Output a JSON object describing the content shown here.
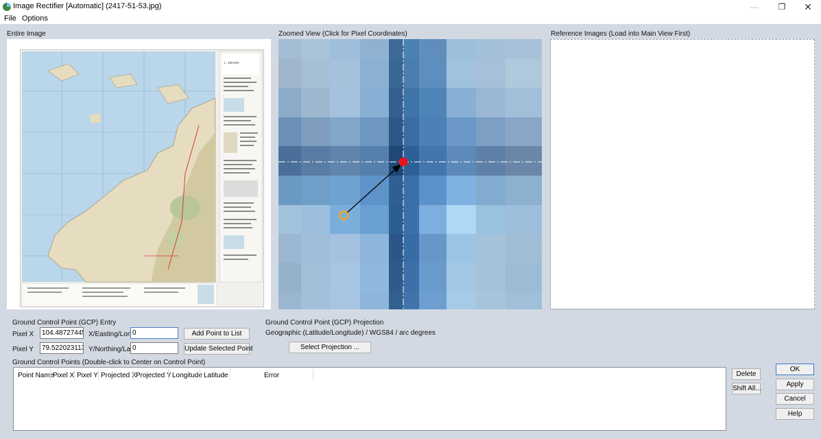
{
  "window": {
    "title": "Image Rectifier [Automatic] (2417-51-53.jpg)",
    "controls": {
      "minimize": "—",
      "maximize": "❐",
      "close": "✕"
    }
  },
  "menu": {
    "items": [
      "File",
      "Options"
    ]
  },
  "panels": {
    "entire_image_label": "Entire Image",
    "zoomed_view_label": "Zoomed View (Click for Pixel Coordinates)",
    "reference_label": "Reference Images (Load into Main View First)"
  },
  "zoom": {
    "grid_colors": [
      [
        "#a4bcd4",
        "#a9c4d9",
        "#9fbedc",
        "#8fb2d3",
        "#3e6a9a",
        "#4b80b2",
        "#5f8ebd",
        "#9ebfda",
        "#a4c0d8",
        "#a7c1d8"
      ],
      [
        "#9fb6cc",
        "#a7bfd4",
        "#a5c1db",
        "#8ab0d2",
        "#3b6797",
        "#4a7eb1",
        "#5d8ebe",
        "#a1c2df",
        "#a5c0d8",
        "#b0c8dc"
      ],
      [
        "#8cabc8",
        "#9db7cf",
        "#a4c2dd",
        "#88b0d4",
        "#355f8f",
        "#3f74a8",
        "#4f84b9",
        "#88b0d4",
        "#9ab8d6",
        "#a2bfd9"
      ],
      [
        "#6b8fb5",
        "#7f9dbf",
        "#81a6c8",
        "#6e98c1",
        "#2d5788",
        "#3a6ea3",
        "#4b80b8",
        "#6b98c6",
        "#7e9fc4",
        "#8aa6c6"
      ],
      [
        "#4a6f98",
        "#587ca4",
        "#5f85ad",
        "#557fac",
        "#1f4878",
        "#2f5f97",
        "#4375ae",
        "#5d89b9",
        "#5f80a8",
        "#6a86a8"
      ],
      [
        "#6a99c2",
        "#6f9ec8",
        "#6ea2d0",
        "#5d93c8",
        "#2f5f93",
        "#3a70a9",
        "#5b92cc",
        "#7fb2e0",
        "#82abd0",
        "#8bb0d0"
      ],
      [
        "#a2c2de",
        "#9cbfe0",
        "#7aaedb",
        "#6a9fd3",
        "#2d5d91",
        "#3b71aa",
        "#7eaedd",
        "#aed8f5",
        "#99c1e0",
        "#9dbfdc"
      ],
      [
        "#9bb6d0",
        "#a0bed9",
        "#a4c2e0",
        "#8eb6dc",
        "#2b568a",
        "#386ca5",
        "#6797c9",
        "#9cc4e4",
        "#a4c3db",
        "#a0bfd7"
      ],
      [
        "#95b2cd",
        "#a2bfda",
        "#a8c6e2",
        "#8fb8de",
        "#2f5a8c",
        "#3d70a8",
        "#6a9bcd",
        "#a3c8e6",
        "#a6c2da",
        "#9cbcd6"
      ],
      [
        "#9ab6d1",
        "#a3c0db",
        "#a7c5e1",
        "#8eb6dc",
        "#32608f",
        "#4174ab",
        "#6d9ecf",
        "#a6cbe8",
        "#a8c4dc",
        "#a0bfd8"
      ]
    ],
    "marker_colors": {
      "target": "#e8141c",
      "source": "#f0a81c",
      "arrow": "#000000",
      "crosshair": "#ffffff"
    }
  },
  "gcp_entry": {
    "label": "Ground Control Point (GCP) Entry",
    "pixel_x_label": "Pixel X",
    "pixel_x_value": "104.4872744593",
    "pixel_y_label": "Pixel Y",
    "pixel_y_value": "79.5220231133",
    "x_label": "X/Easting/Lon",
    "x_value": "0",
    "y_label": "Y/Northing/Lat",
    "y_value": "0",
    "add_button": "Add Point to List",
    "update_button": "Update Selected Point"
  },
  "gcp_projection": {
    "label": "Ground Control Point (GCP) Projection",
    "value": "Geographic (Latitude/Longitude) / WGS84 / arc degrees",
    "select_button": "Select Projection ..."
  },
  "gcp_list": {
    "label": "Ground Control Points (Double-click to Center on Control Point)",
    "columns": [
      "Point Name",
      "Pixel X",
      "Pixel Y",
      "Projected X",
      "Projected Y",
      "Longitude",
      "Latitude",
      "Error"
    ]
  },
  "side_buttons": {
    "delete": "Delete",
    "shift_all": "Shift All..."
  },
  "dialog_buttons": {
    "ok": "OK",
    "apply": "Apply",
    "cancel": "Cancel",
    "help": "Help"
  },
  "map": {
    "legend_title": "1 : 250,000"
  }
}
